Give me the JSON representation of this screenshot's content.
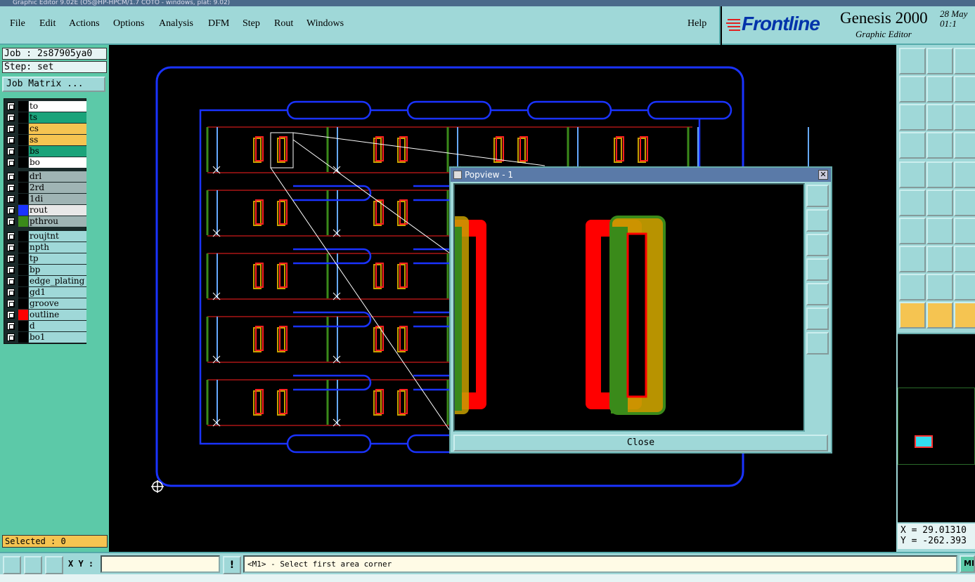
{
  "window": {
    "title": "Graphic Editor 9.02E (OS@HP-HPCM/1.7 COTO - windows, plat: 9.02)"
  },
  "menu": {
    "file": "File",
    "edit": "Edit",
    "actions": "Actions",
    "options": "Options",
    "analysis": "Analysis",
    "dfm": "DFM",
    "step": "Step",
    "rout": "Rout",
    "windows": "Windows",
    "help": "Help"
  },
  "brand": {
    "logo": "Frontline",
    "product": "Genesis 2000",
    "subtitle": "Graphic Editor",
    "date": "28 May\n01:1"
  },
  "left": {
    "job_label": "Job : 2s87905ya0",
    "step_label": "Step: set",
    "job_matrix_button": "Job Matrix ...",
    "selected_label": "Selected : 0"
  },
  "layers": [
    {
      "name": "to",
      "bg": "#ffffff",
      "swatch": "#000000"
    },
    {
      "name": "ts",
      "bg": "#1aa37a",
      "swatch": "#000000"
    },
    {
      "name": "cs",
      "bg": "#f5c451",
      "swatch": "#000000"
    },
    {
      "name": "ss",
      "bg": "#f5c451",
      "swatch": "#000000"
    },
    {
      "name": "bs",
      "bg": "#1aa37a",
      "swatch": "#000000"
    },
    {
      "name": "bo",
      "bg": "#ffffff",
      "swatch": "#000000"
    },
    {
      "name": "drl",
      "bg": "#9fb4b4",
      "swatch": "#000000"
    },
    {
      "name": "2rd",
      "bg": "#9fb4b4",
      "swatch": "#000000"
    },
    {
      "name": "1di",
      "bg": "#9fb4b4",
      "swatch": "#000000"
    },
    {
      "name": "rout",
      "bg": "#e8e8e8",
      "swatch": "#1a33ff"
    },
    {
      "name": "pthrou",
      "bg": "#9fb4b4",
      "swatch": "#3a8a1a"
    },
    {
      "name": "roujtnt",
      "bg": "#9fd8d8",
      "swatch": "#000000"
    },
    {
      "name": "npth",
      "bg": "#9fd8d8",
      "swatch": "#000000"
    },
    {
      "name": "tp",
      "bg": "#9fd8d8",
      "swatch": "#000000"
    },
    {
      "name": "bp",
      "bg": "#9fd8d8",
      "swatch": "#000000"
    },
    {
      "name": "edge_plating",
      "bg": "#9fd8d8",
      "swatch": "#000000"
    },
    {
      "name": "gd1",
      "bg": "#9fd8d8",
      "swatch": "#000000"
    },
    {
      "name": "groove",
      "bg": "#9fd8d8",
      "swatch": "#000000"
    },
    {
      "name": "outline",
      "bg": "#9fd8d8",
      "swatch": "#ff0000"
    },
    {
      "name": "d",
      "bg": "#9fd8d8",
      "swatch": "#000000"
    },
    {
      "name": "bo1",
      "bg": "#9fd8d8",
      "swatch": "#000000"
    }
  ],
  "popview": {
    "title": "Popview - 1",
    "close_button": "Close"
  },
  "coords": {
    "x": "X = 29.01310",
    "y": "Y = -262.393"
  },
  "statusbar": {
    "xy_label": "X Y :",
    "xy_value": "",
    "message": "<M1> - Select first area corner",
    "units": "MM"
  },
  "colors": {
    "panel": "#9fd8d8",
    "layer_green": "#5cc9a8",
    "orange": "#f5c451",
    "rout_blue": "#1a33ff",
    "outline_red": "#ff0000",
    "pthrou_green": "#3a8a1a"
  }
}
